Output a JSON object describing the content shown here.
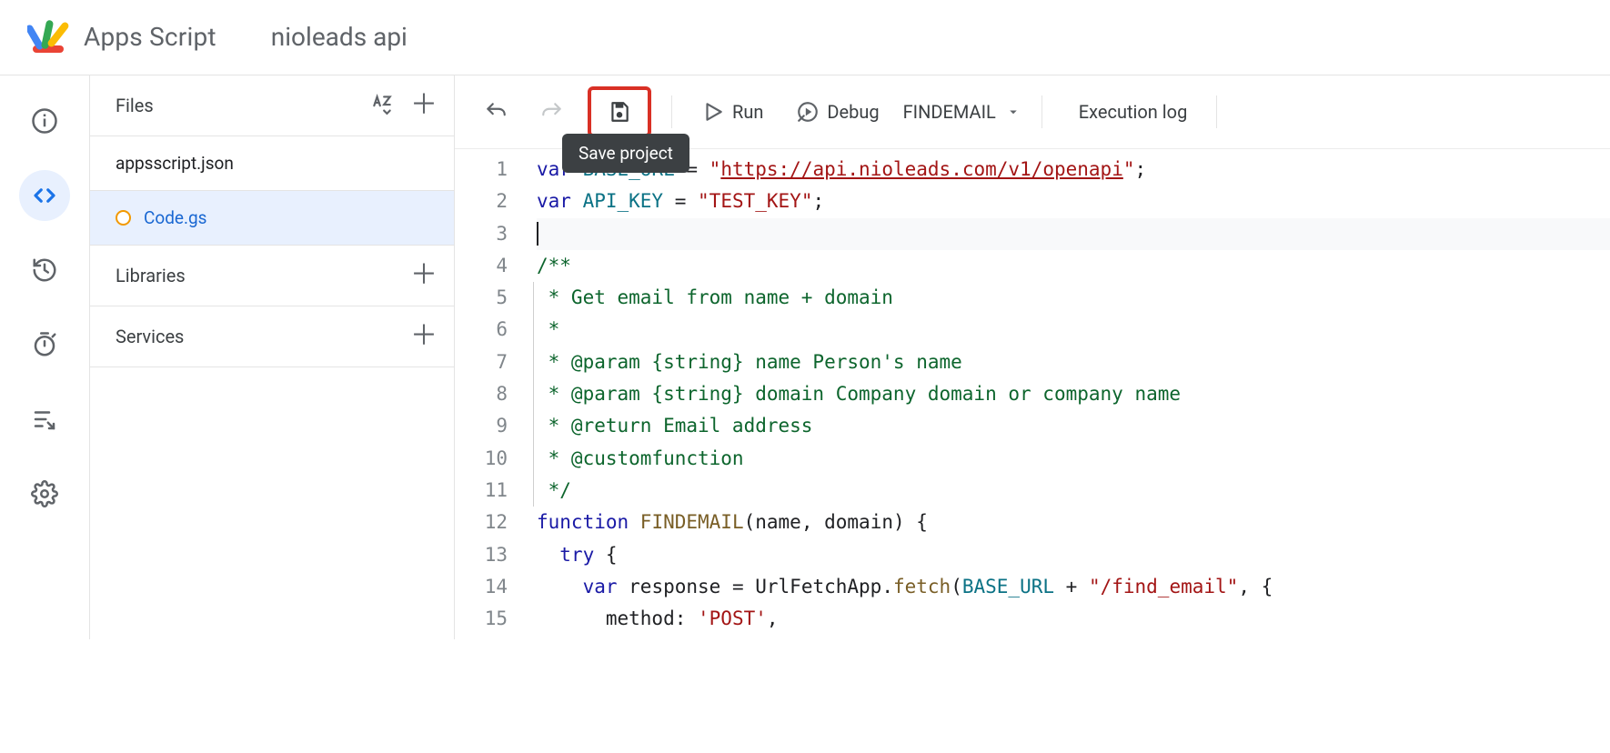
{
  "header": {
    "product_name": "Apps Script",
    "project_name": "nioleads api"
  },
  "sidebar": {
    "files_label": "Files",
    "libraries_label": "Libraries",
    "services_label": "Services",
    "files": [
      {
        "name": "appsscript.json",
        "active": false
      },
      {
        "name": "Code.gs",
        "active": true,
        "modified": true
      }
    ]
  },
  "toolbar": {
    "run_label": "Run",
    "debug_label": "Debug",
    "fn_selected": "FINDEMAIL",
    "exec_log_label": "Execution log",
    "save_tooltip": "Save project"
  },
  "code": {
    "lines": [
      {
        "n": 1,
        "tokens": [
          [
            "kw",
            "var "
          ],
          [
            "gv",
            "BASE_URL"
          ],
          [
            "op",
            " = "
          ],
          [
            "str",
            "\""
          ],
          [
            "url",
            "https://api.nioleads.com/v1/openapi"
          ],
          [
            "str",
            "\""
          ],
          [
            "op",
            ";"
          ]
        ]
      },
      {
        "n": 2,
        "tokens": [
          [
            "kw",
            "var "
          ],
          [
            "gv",
            "API_KEY"
          ],
          [
            "op",
            " = "
          ],
          [
            "str",
            "\"TEST_KEY\""
          ],
          [
            "op",
            ";"
          ]
        ]
      },
      {
        "n": 3,
        "current": true,
        "tokens": [
          [
            "cursor",
            ""
          ]
        ]
      },
      {
        "n": 4,
        "tokens": [
          [
            "cmt",
            "/**"
          ]
        ]
      },
      {
        "n": 5,
        "doc": true,
        "tokens": [
          [
            "cmt",
            " * Get email from name + domain"
          ]
        ]
      },
      {
        "n": 6,
        "doc": true,
        "tokens": [
          [
            "cmt",
            " * "
          ]
        ]
      },
      {
        "n": 7,
        "doc": true,
        "tokens": [
          [
            "cmt",
            " * @param {string} name Person's name"
          ]
        ]
      },
      {
        "n": 8,
        "doc": true,
        "tokens": [
          [
            "cmt",
            " * @param {string} domain Company domain or company name"
          ]
        ]
      },
      {
        "n": 9,
        "doc": true,
        "tokens": [
          [
            "cmt",
            " * @return Email address"
          ]
        ]
      },
      {
        "n": 10,
        "doc": true,
        "tokens": [
          [
            "cmt",
            " * @customfunction"
          ]
        ]
      },
      {
        "n": 11,
        "doc": true,
        "tokens": [
          [
            "cmt",
            " */"
          ]
        ]
      },
      {
        "n": 12,
        "tokens": [
          [
            "kw",
            "function "
          ],
          [
            "call",
            "FINDEMAIL"
          ],
          [
            "op",
            "("
          ],
          [
            "id",
            "name"
          ],
          [
            "op",
            ", "
          ],
          [
            "id",
            "domain"
          ],
          [
            "op",
            ") {"
          ]
        ]
      },
      {
        "n": 13,
        "tokens": [
          [
            "op",
            "  "
          ],
          [
            "kw",
            "try"
          ],
          [
            "op",
            " {"
          ]
        ]
      },
      {
        "n": 14,
        "tokens": [
          [
            "op",
            "    "
          ],
          [
            "kw",
            "var "
          ],
          [
            "id",
            "response"
          ],
          [
            "op",
            " = "
          ],
          [
            "id",
            "UrlFetchApp"
          ],
          [
            "op",
            "."
          ],
          [
            "call",
            "fetch"
          ],
          [
            "op",
            "("
          ],
          [
            "gv",
            "BASE_URL"
          ],
          [
            "op",
            " + "
          ],
          [
            "str",
            "\"/find_email\""
          ],
          [
            "op",
            ", {"
          ]
        ]
      },
      {
        "n": 15,
        "tokens": [
          [
            "op",
            "      "
          ],
          [
            "id",
            "method"
          ],
          [
            "op",
            ": "
          ],
          [
            "str",
            "'POST'"
          ],
          [
            "op",
            ","
          ]
        ]
      }
    ]
  }
}
